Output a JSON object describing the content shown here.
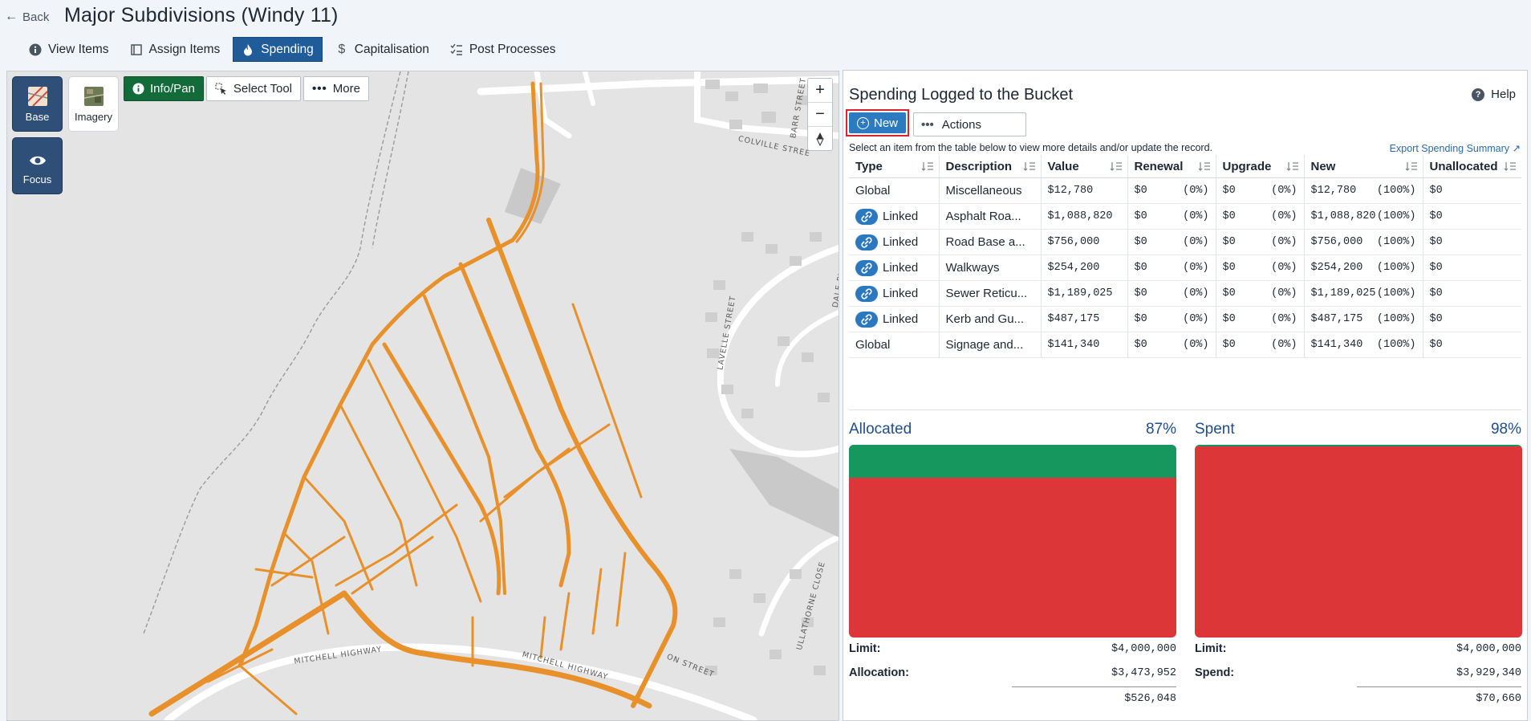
{
  "header": {
    "back_label": "Back",
    "title": "Major Subdivisions (Windy 11)",
    "tabs": [
      {
        "label": "View Items",
        "icon": "info-icon"
      },
      {
        "label": "Assign Items",
        "icon": "book-icon"
      },
      {
        "label": "Spending",
        "icon": "flame-icon",
        "active": true
      },
      {
        "label": "Capitalisation",
        "icon": "dollar-icon"
      },
      {
        "label": "Post Processes",
        "icon": "list-check-icon"
      }
    ]
  },
  "map": {
    "layers": {
      "base": "Base",
      "imagery": "Imagery",
      "focus": "Focus"
    },
    "tools": {
      "info_pan": "Info/Pan",
      "select_tool": "Select Tool",
      "more": "More"
    },
    "zoom": {
      "in": "+",
      "out": "−"
    },
    "streets": {
      "barr": "BARR STREET",
      "colville": "COLVILLE STREE",
      "dale": "DALE PLACE",
      "lavelle": "LAVELLE STREET",
      "ullathorne": "ULLATHORNE CLOSE",
      "mitchell1": "MITCHELL HIGHWAY",
      "mitchell2": "MITCHELL HIGHWAY",
      "on": "ON STREET"
    },
    "accent_color": "#e8912b"
  },
  "panel": {
    "title": "Spending Logged to the Bucket",
    "help_label": "Help",
    "new_label": "New",
    "actions_label": "Actions",
    "hint": "Select an item from the table below to view more details and/or update the record.",
    "export_label": "Export Spending Summary ↗",
    "table": {
      "headers": [
        "Type",
        "Description",
        "Value",
        "Renewal",
        "Upgrade",
        "New",
        "Unallocated"
      ],
      "rows": [
        {
          "type": "Global",
          "linked": false,
          "description": "Miscellaneous",
          "value": "$12,780",
          "renewal": "$0",
          "renewal_pct": "(0%)",
          "upgrade": "$0",
          "upgrade_pct": "(0%)",
          "new": "$12,780",
          "new_pct": "(100%)",
          "unallocated": "$0"
        },
        {
          "type": "Linked",
          "linked": true,
          "description": "Asphalt Roa...",
          "value": "$1,088,820",
          "renewal": "$0",
          "renewal_pct": "(0%)",
          "upgrade": "$0",
          "upgrade_pct": "(0%)",
          "new": "$1,088,820",
          "new_pct": "(100%)",
          "unallocated": "$0"
        },
        {
          "type": "Linked",
          "linked": true,
          "description": "Road Base a...",
          "value": "$756,000",
          "renewal": "$0",
          "renewal_pct": "(0%)",
          "upgrade": "$0",
          "upgrade_pct": "(0%)",
          "new": "$756,000",
          "new_pct": "(100%)",
          "unallocated": "$0"
        },
        {
          "type": "Linked",
          "linked": true,
          "description": "Walkways",
          "value": "$254,200",
          "renewal": "$0",
          "renewal_pct": "(0%)",
          "upgrade": "$0",
          "upgrade_pct": "(0%)",
          "new": "$254,200",
          "new_pct": "(100%)",
          "unallocated": "$0"
        },
        {
          "type": "Linked",
          "linked": true,
          "description": "Sewer Reticu...",
          "value": "$1,189,025",
          "renewal": "$0",
          "renewal_pct": "(0%)",
          "upgrade": "$0",
          "upgrade_pct": "(0%)",
          "new": "$1,189,025",
          "new_pct": "(100%)",
          "unallocated": "$0"
        },
        {
          "type": "Linked",
          "linked": true,
          "description": "Kerb and Gu...",
          "value": "$487,175",
          "renewal": "$0",
          "renewal_pct": "(0%)",
          "upgrade": "$0",
          "upgrade_pct": "(0%)",
          "new": "$487,175",
          "new_pct": "(100%)",
          "unallocated": "$0"
        },
        {
          "type": "Global",
          "linked": false,
          "description": "Signage and...",
          "value": "$141,340",
          "renewal": "$0",
          "renewal_pct": "(0%)",
          "upgrade": "$0",
          "upgrade_pct": "(0%)",
          "new": "$141,340",
          "new_pct": "(100%)",
          "unallocated": "$0"
        }
      ]
    },
    "allocated": {
      "title": "Allocated",
      "percent": "87%",
      "fill_fraction": 0.87,
      "limit_label": "Limit:",
      "limit": "$4,000,000",
      "second_label": "Allocation:",
      "second": "$3,473,952",
      "remaining": "$526,048"
    },
    "spent": {
      "title": "Spent",
      "percent": "98%",
      "fill_fraction": 0.98,
      "limit_label": "Limit:",
      "limit": "$4,000,000",
      "second_label": "Spend:",
      "second": "$3,929,340",
      "remaining": "$70,660"
    },
    "colors": {
      "green": "#16975e",
      "red": "#dc3639",
      "accent_blue": "#1f5c99"
    }
  }
}
